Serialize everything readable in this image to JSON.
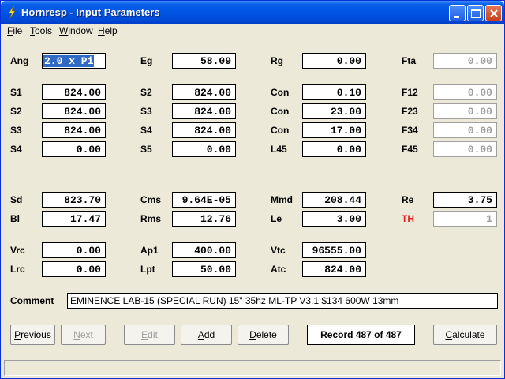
{
  "window": {
    "title": "Hornresp - Input Parameters"
  },
  "menu": [
    {
      "label": "File",
      "key": "F",
      "rest": "ile"
    },
    {
      "label": "Tools",
      "key": "T",
      "rest": "ools"
    },
    {
      "label": "Window",
      "key": "W",
      "rest": "indow"
    },
    {
      "label": "Help",
      "key": "H",
      "rest": "elp"
    }
  ],
  "params": {
    "ang": {
      "label": "Ang",
      "value": "2.0 x Pi"
    },
    "eg": {
      "label": "Eg",
      "value": "58.09"
    },
    "rg": {
      "label": "Rg",
      "value": "0.00"
    },
    "fta": {
      "label": "Fta",
      "value": "0.00"
    },
    "s1a": {
      "label": "S1",
      "value": "824.00"
    },
    "s2a": {
      "label": "S2",
      "value": "824.00"
    },
    "con1": {
      "label": "Con",
      "value": "0.10"
    },
    "f12": {
      "label": "F12",
      "value": "0.00"
    },
    "s2b": {
      "label": "S2",
      "value": "824.00"
    },
    "s3a": {
      "label": "S3",
      "value": "824.00"
    },
    "con2": {
      "label": "Con",
      "value": "23.00"
    },
    "f23": {
      "label": "F23",
      "value": "0.00"
    },
    "s3b": {
      "label": "S3",
      "value": "824.00"
    },
    "s4a": {
      "label": "S4",
      "value": "824.00"
    },
    "con3": {
      "label": "Con",
      "value": "17.00"
    },
    "f34": {
      "label": "F34",
      "value": "0.00"
    },
    "s4b": {
      "label": "S4",
      "value": "0.00"
    },
    "s5": {
      "label": "S5",
      "value": "0.00"
    },
    "l45": {
      "label": "L45",
      "value": "0.00"
    },
    "f45": {
      "label": "F45",
      "value": "0.00"
    },
    "sd": {
      "label": "Sd",
      "value": "823.70"
    },
    "cms": {
      "label": "Cms",
      "value": "9.64E-05"
    },
    "mmd": {
      "label": "Mmd",
      "value": "208.44"
    },
    "re": {
      "label": "Re",
      "value": "3.75"
    },
    "bl": {
      "label": "Bl",
      "value": "17.47"
    },
    "rms": {
      "label": "Rms",
      "value": "12.76"
    },
    "le": {
      "label": "Le",
      "value": "3.00"
    },
    "th": {
      "label": "TH",
      "value": "1"
    },
    "vrc": {
      "label": "Vrc",
      "value": "0.00"
    },
    "ap1": {
      "label": "Ap1",
      "value": "400.00"
    },
    "vtc": {
      "label": "Vtc",
      "value": "96555.00"
    },
    "lrc": {
      "label": "Lrc",
      "value": "0.00"
    },
    "lpt": {
      "label": "Lpt",
      "value": "50.00"
    },
    "atc": {
      "label": "Atc",
      "value": "824.00"
    }
  },
  "comment": {
    "label": "Comment",
    "value": "EMINENCE LAB-15 (SPECIAL RUN) 15\" 35hz ML-TP V3.1 $134 600W 13mm"
  },
  "buttons": {
    "previous": {
      "label": "Previous",
      "key": "P",
      "rest": "revious"
    },
    "next": {
      "label": "Next",
      "key": "N",
      "rest": "ext"
    },
    "edit": {
      "label": "Edit",
      "key": "E",
      "rest": "dit"
    },
    "add": {
      "label": "Add",
      "key": "A",
      "rest": "dd"
    },
    "delete": {
      "label": "Delete",
      "key": "D",
      "rest": "elete"
    },
    "calculate": {
      "label": "Calculate",
      "key": "C",
      "rest": "alculate"
    }
  },
  "record": "Record 487 of 487",
  "colors": {
    "titlebar": "#0054E3",
    "window_bg": "#ECE9D8",
    "th_label": "#E02020",
    "selection": "#316AC5"
  }
}
